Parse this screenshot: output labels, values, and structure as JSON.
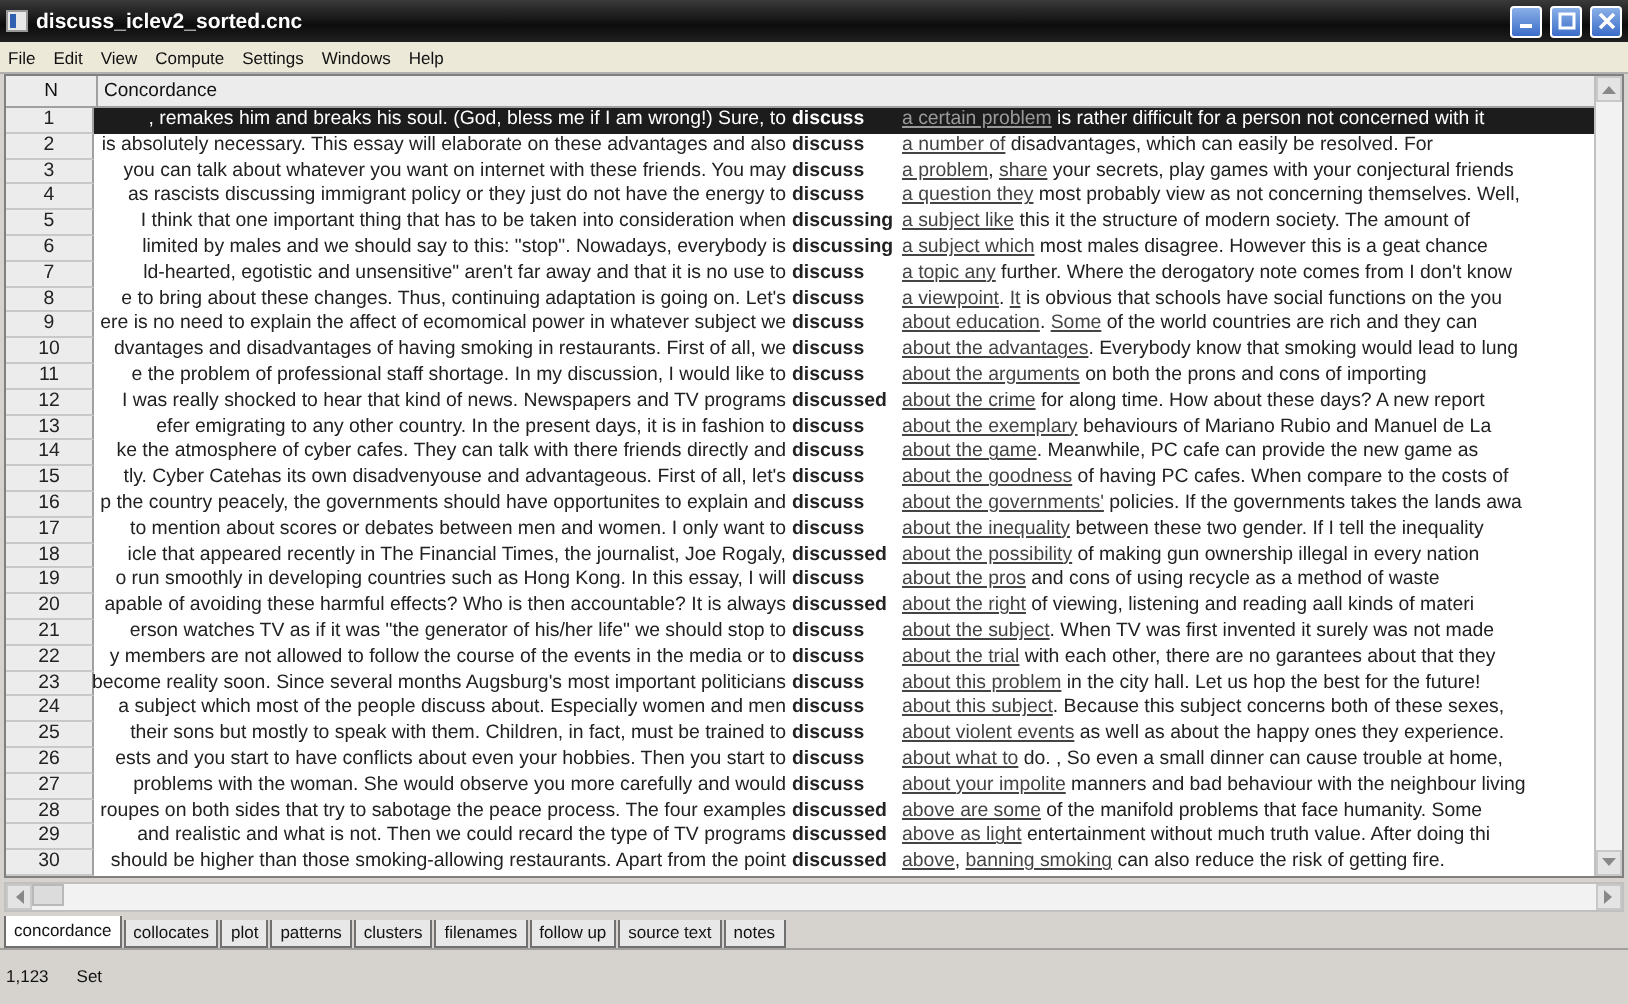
{
  "window": {
    "title": "discuss_iclev2_sorted.cnc"
  },
  "menu": [
    "File",
    "Edit",
    "View",
    "Compute",
    "Settings",
    "Windows",
    "Help"
  ],
  "table": {
    "columns": [
      "N",
      "Concordance"
    ],
    "rows": [
      {
        "n": "1",
        "selected": true,
        "left": ", remakes him and breaks his soul. (God, bless me if I am wrong!) Sure, to",
        "keyword": "discuss",
        "right": [
          {
            "text": "a certain problem",
            "underlined": true
          },
          {
            "text": " is rather difficult for a person not concerned with it",
            "underlined": false
          }
        ]
      },
      {
        "n": "2",
        "selected": false,
        "left": "is absolutely necessary. This essay will elaborate on these advantages and also",
        "keyword": "discuss",
        "right": [
          {
            "text": "a number of",
            "underlined": true
          },
          {
            "text": " disadvantages, which can easily be resolved. For",
            "underlined": false
          }
        ]
      },
      {
        "n": "3",
        "selected": false,
        "left": "you can talk about whatever you want on internet with these friends. You may",
        "keyword": "discuss",
        "right": [
          {
            "text": "a problem",
            "underlined": true,
            "after": ", "
          },
          {
            "text": "share",
            "underlined": true
          },
          {
            "text": " your secrets, play games with your conjectural friends",
            "underlined": false
          }
        ]
      },
      {
        "n": "4",
        "selected": false,
        "left": "as rascists discussing immigrant policy or they just do not have the energy to",
        "keyword": "discuss",
        "right": [
          {
            "text": "a question they",
            "underlined": true
          },
          {
            "text": " most probably view as not concerning themselves. Well,",
            "underlined": false
          }
        ]
      },
      {
        "n": "5",
        "selected": false,
        "left": "I think that one important thing that has to be taken into consideration when",
        "keyword": "discussing",
        "right": [
          {
            "text": "a subject like",
            "underlined": true
          },
          {
            "text": " this it the structure of modern society. The amount of",
            "underlined": false
          }
        ]
      },
      {
        "n": "6",
        "selected": false,
        "left": "limited by males and we should say to this: \"stop\". Nowadays, everybody is",
        "keyword": "discussing",
        "right": [
          {
            "text": "a subject which",
            "underlined": true
          },
          {
            "text": " most males disagree. However this is a geat chance",
            "underlined": false
          }
        ]
      },
      {
        "n": "7",
        "selected": false,
        "left": "ld-hearted, egotistic and unsensitive\" aren't far away and that it is no use to",
        "keyword": "discuss",
        "right": [
          {
            "text": "a topic any",
            "underlined": true
          },
          {
            "text": " further. Where the derogatory note comes from I don't know",
            "underlined": false
          }
        ]
      },
      {
        "n": "8",
        "selected": false,
        "left": "e to bring about these changes. Thus, continuing adaptation is going on. Let's",
        "keyword": "discuss",
        "right": [
          {
            "text": "a viewpoint",
            "underlined": true,
            "after": ". "
          },
          {
            "text": "It",
            "underlined": true
          },
          {
            "text": " is obvious that schools have social functions on the you",
            "underlined": false
          }
        ]
      },
      {
        "n": "9",
        "selected": false,
        "left": "ere is no need to explain the affect of ecomomical power in whatever subject we",
        "keyword": "discuss",
        "right": [
          {
            "text": "about education",
            "underlined": true,
            "after": ". "
          },
          {
            "text": "Some",
            "underlined": true
          },
          {
            "text": " of the world countries are rich and they can",
            "underlined": false
          }
        ]
      },
      {
        "n": "10",
        "selected": false,
        "left": "dvantages and disadvantages of having smoking in restaurants. First of all, we",
        "keyword": "discuss",
        "right": [
          {
            "text": "about the advantages",
            "underlined": true
          },
          {
            "text": ". Everybody know that smoking would lead to lung",
            "underlined": false
          }
        ]
      },
      {
        "n": "11",
        "selected": false,
        "left": "e the problem of professional staff shortage. In my discussion, I would like to",
        "keyword": "discuss",
        "right": [
          {
            "text": "about the arguments",
            "underlined": true
          },
          {
            "text": " on both the prons and cons of importing",
            "underlined": false
          }
        ]
      },
      {
        "n": "12",
        "selected": false,
        "left": "I was really shocked to hear that kind of news. Newspapers and TV programs",
        "keyword": "discussed",
        "right": [
          {
            "text": "about the crime",
            "underlined": true
          },
          {
            "text": " for along time. How about these days? A new report",
            "underlined": false
          }
        ]
      },
      {
        "n": "13",
        "selected": false,
        "left": "efer emigrating to any other country. In the present days, it is in fashion to",
        "keyword": "discuss",
        "right": [
          {
            "text": "about the exemplary",
            "underlined": true
          },
          {
            "text": " behaviours of Mariano Rubio and Manuel de La",
            "underlined": false
          }
        ]
      },
      {
        "n": "14",
        "selected": false,
        "left": "ke the atmosphere of cyber cafes. They can talk with there friends directly and",
        "keyword": "discuss",
        "right": [
          {
            "text": "about the game",
            "underlined": true
          },
          {
            "text": ". Meanwhile, PC cafe can provide the new game as",
            "underlined": false
          }
        ]
      },
      {
        "n": "15",
        "selected": false,
        "left": "tly. Cyber Catehas its own disadvenyouse and advantageous. First of all, let's",
        "keyword": "discuss",
        "right": [
          {
            "text": "about the goodness",
            "underlined": true
          },
          {
            "text": " of having PC cafes. When compare to the costs of",
            "underlined": false
          }
        ]
      },
      {
        "n": "16",
        "selected": false,
        "left": "p the country peacely, the governments should have opportunites to explain and",
        "keyword": "discuss",
        "right": [
          {
            "text": "about the governments'",
            "underlined": true
          },
          {
            "text": " policies. If the governments takes the lands awa",
            "underlined": false
          }
        ]
      },
      {
        "n": "17",
        "selected": false,
        "left": "to mention about scores or debates between men and women. I only want to",
        "keyword": "discuss",
        "right": [
          {
            "text": "about the inequality",
            "underlined": true
          },
          {
            "text": " between these two gender. If I tell the inequality",
            "underlined": false
          }
        ]
      },
      {
        "n": "18",
        "selected": false,
        "left": "icle that appeared recently in The Financial Times, the journalist, Joe Rogaly,",
        "keyword": "discussed",
        "right": [
          {
            "text": "about the possibility",
            "underlined": true
          },
          {
            "text": " of making gun ownership illegal in every nation",
            "underlined": false
          }
        ]
      },
      {
        "n": "19",
        "selected": false,
        "left": "o run smoothly in developing countries such as Hong Kong. In this essay, I will",
        "keyword": "discuss",
        "right": [
          {
            "text": "about the pros",
            "underlined": true
          },
          {
            "text": " and cons of using recycle as a method of waste",
            "underlined": false
          }
        ]
      },
      {
        "n": "20",
        "selected": false,
        "left": "apable of avoiding these harmful effects? Who is then accountable? It is always",
        "keyword": "discussed",
        "right": [
          {
            "text": "about the right",
            "underlined": true
          },
          {
            "text": " of viewing, listening and reading aall kinds of materi",
            "underlined": false
          }
        ]
      },
      {
        "n": "21",
        "selected": false,
        "left": "erson watches TV as if it was \"the generator of his/her life\" we should stop to",
        "keyword": "discuss",
        "right": [
          {
            "text": "about the subject",
            "underlined": true
          },
          {
            "text": ". When TV was first invented it surely was not made",
            "underlined": false
          }
        ]
      },
      {
        "n": "22",
        "selected": false,
        "left": "y members are not allowed to follow the course of the events in the media or to",
        "keyword": "discuss",
        "right": [
          {
            "text": "about the trial",
            "underlined": true
          },
          {
            "text": " with each other, there are no garantees about that they",
            "underlined": false
          }
        ]
      },
      {
        "n": "23",
        "selected": false,
        "left": "become reality soon. Since several months Augsburg's most important politicians",
        "keyword": "discuss",
        "right": [
          {
            "text": "about this problem",
            "underlined": true
          },
          {
            "text": " in the city hall. Let us hop the best for the future!",
            "underlined": false
          }
        ]
      },
      {
        "n": "24",
        "selected": false,
        "left": "a subject which most of the people discuss about. Especially women and men",
        "keyword": "discuss",
        "right": [
          {
            "text": "about this subject",
            "underlined": true
          },
          {
            "text": ". Because this subject concerns both of these sexes,",
            "underlined": false
          }
        ]
      },
      {
        "n": "25",
        "selected": false,
        "left": "their sons but mostly to speak with them. Children, in fact, must be trained to",
        "keyword": "discuss",
        "right": [
          {
            "text": "about violent events",
            "underlined": true
          },
          {
            "text": " as well as about the happy ones they experience.",
            "underlined": false
          }
        ]
      },
      {
        "n": "26",
        "selected": false,
        "left": "ests and you start to have conflicts about even your hobbies. Then you start to",
        "keyword": "discuss",
        "right": [
          {
            "text": "about what to",
            "underlined": true
          },
          {
            "text": " do. , So even a small dinner can cause trouble at home,",
            "underlined": false
          }
        ]
      },
      {
        "n": "27",
        "selected": false,
        "left": "problems with the woman. She would observe you more carefully and would",
        "keyword": "discuss",
        "right": [
          {
            "text": "about your impolite",
            "underlined": true
          },
          {
            "text": " manners and bad behaviour with the neighbour living",
            "underlined": false
          }
        ]
      },
      {
        "n": "28",
        "selected": false,
        "left": "roupes on both sides that try to sabotage the peace process. The four examples",
        "keyword": "discussed",
        "right": [
          {
            "text": "above are some",
            "underlined": true
          },
          {
            "text": " of the manifold problems that face humanity. Some",
            "underlined": false
          }
        ]
      },
      {
        "n": "29",
        "selected": false,
        "left": "and realistic and what is not. Then we could recard the type of TV programs",
        "keyword": "discussed",
        "right": [
          {
            "text": "above as light",
            "underlined": true
          },
          {
            "text": " entertainment without much truth value. After doing thi",
            "underlined": false
          }
        ]
      },
      {
        "n": "30",
        "selected": false,
        "left": "should be higher than those smoking-allowing restaurants. Apart from the point",
        "keyword": "discussed",
        "right": [
          {
            "text": "above",
            "underlined": true,
            "after": ", "
          },
          {
            "text": "banning smoking",
            "underlined": true
          },
          {
            "text": " can also reduce the risk of getting fire.",
            "underlined": false
          }
        ]
      }
    ]
  },
  "tabs": [
    {
      "label": "concordance",
      "selected": true
    },
    {
      "label": "collocates",
      "selected": false
    },
    {
      "label": "plot",
      "selected": false
    },
    {
      "label": "patterns",
      "selected": false
    },
    {
      "label": "clusters",
      "selected": false
    },
    {
      "label": "filenames",
      "selected": false
    },
    {
      "label": "follow up",
      "selected": false
    },
    {
      "label": "source text",
      "selected": false
    },
    {
      "label": "notes",
      "selected": false
    }
  ],
  "status_bar": [
    "1,123",
    "Set"
  ]
}
